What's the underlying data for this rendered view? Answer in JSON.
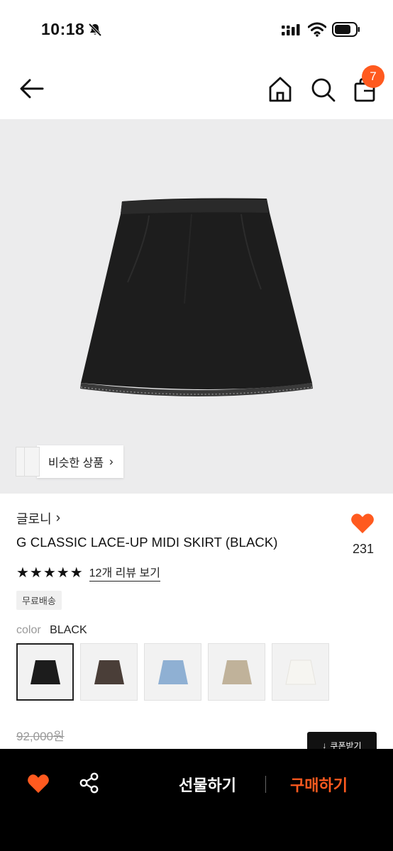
{
  "status_bar": {
    "time": "10:18"
  },
  "nav": {
    "cart_count": "7"
  },
  "hero": {
    "similar_label": "비슷한 상품"
  },
  "product": {
    "brand": "글로니",
    "title": "G CLASSIC LACE-UP MIDI SKIRT (BLACK)",
    "like_count": "231",
    "stars": "★★★★★",
    "review_link": "12개 리뷰 보기",
    "shipping_tag": "무료배송",
    "color_label": "color",
    "color_value": "BLACK",
    "original_price": "92,000원"
  },
  "color_options": [
    {
      "name": "black",
      "hex": "#1c1c1c",
      "selected": true
    },
    {
      "name": "brown",
      "hex": "#4a3e38",
      "selected": false
    },
    {
      "name": "denim",
      "hex": "#8fb0d3",
      "selected": false
    },
    {
      "name": "beige",
      "hex": "#c0b29a",
      "selected": false
    },
    {
      "name": "white",
      "hex": "#f6f5f1",
      "selected": false
    }
  ],
  "coupon": {
    "label": "쿠폰받기"
  },
  "bottom_bar": {
    "gift_label": "선물하기",
    "buy_label": "구매하기"
  },
  "colors": {
    "accent": "#ff5a1f",
    "dark": "#000000"
  }
}
